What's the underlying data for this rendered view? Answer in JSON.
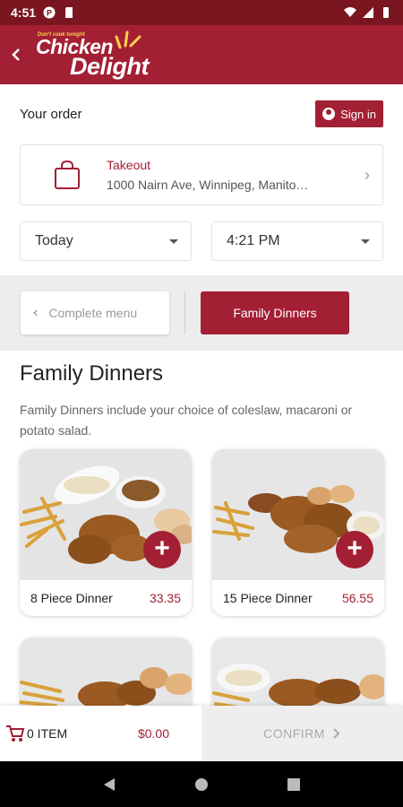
{
  "status_bar": {
    "time": "4:51"
  },
  "header": {
    "logo_tagline": "Don't cook tonight",
    "logo_line1": "Chicken",
    "logo_line2": "Delight"
  },
  "order": {
    "title": "Your order",
    "sign_in_label": "Sign in",
    "mode_label": "Takeout",
    "address": "1000 Nairn Ave, Winnipeg, Manito…",
    "day": "Today",
    "time": "4:21 PM"
  },
  "categories": {
    "back_label": "Complete menu",
    "active_label": "Family Dinners"
  },
  "section": {
    "title": "Family Dinners",
    "description": "Family Dinners include your choice of coleslaw, macaroni or potato salad."
  },
  "items": [
    {
      "name": "8 Piece Dinner",
      "price": "33.35"
    },
    {
      "name": "15 Piece Dinner",
      "price": "56.55"
    }
  ],
  "cart": {
    "count_label": "0 ITEM",
    "total": "$0.00",
    "confirm_label": "CONFIRM"
  },
  "colors": {
    "brand": "#a31f34",
    "accent_gold": "#ffd34d"
  }
}
